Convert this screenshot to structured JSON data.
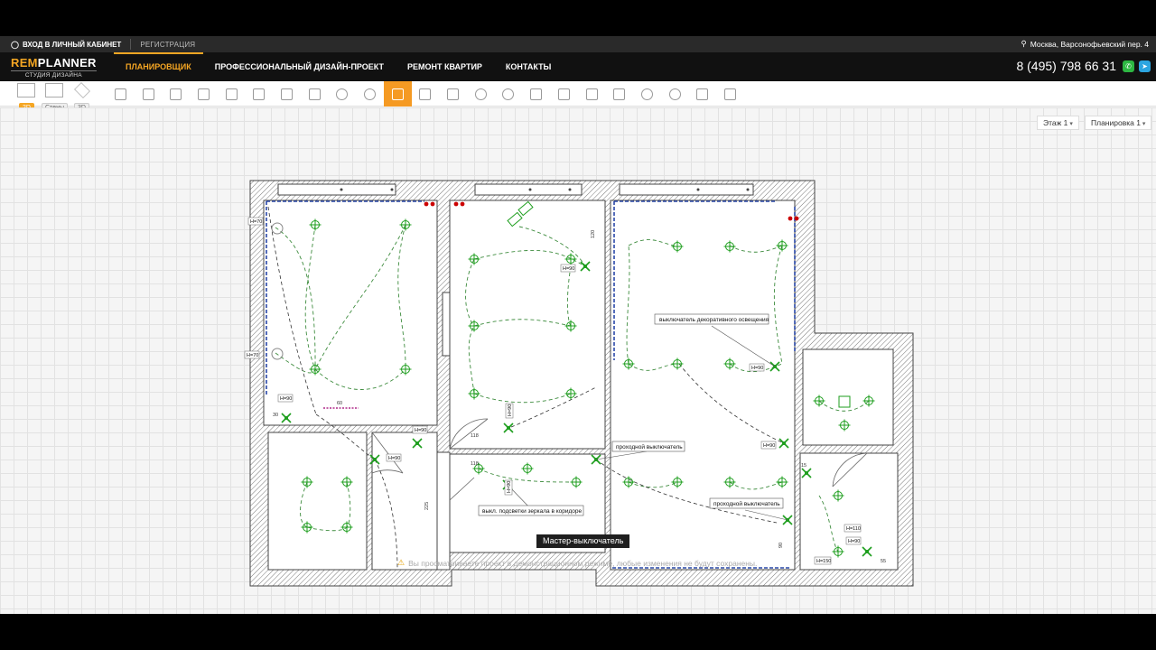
{
  "topbar": {
    "login_label": "ВХОД В ЛИЧНЫЙ КАБИНЕТ",
    "register_label": "РЕГИСТРАЦИЯ",
    "address": "Москва, Варсонофьевский пер. 4"
  },
  "brand": {
    "name_part1": "REM",
    "name_part2": "PLANNER",
    "tagline": "СТУДИЯ ДИЗАЙНА",
    "accent": "#f5a623"
  },
  "nav": {
    "items": [
      "ПЛАНИРОВЩИК",
      "ПРОФЕССИОНАЛЬНЫЙ ДИЗАЙН-ПРОЕКТ",
      "РЕМОНТ КВАРТИР",
      "КОНТАКТЫ"
    ],
    "active_index": 0,
    "phone": "8 (495) 798 66 31",
    "whatsapp_icon": "whatsapp-icon",
    "telegram_icon": "telegram-icon"
  },
  "toolbar": {
    "view_modes": [
      {
        "label": "2D",
        "icon": "plan-2d-icon",
        "active": true
      },
      {
        "label": "Стены",
        "icon": "walls-icon",
        "active": false
      },
      {
        "label": "3D",
        "icon": "cube-3d-icon",
        "active": false
      }
    ],
    "tools": [
      "room-icon",
      "furniture-icon",
      "wall-tile-icon",
      "kitchen-icon",
      "radiator-icon",
      "cabinet-icon",
      "bath-icon",
      "plumbing-icon",
      "socket-icon",
      "ceiling-lamp-icon",
      "switch-icon",
      "floor-heating-icon",
      "ac-icon",
      "fan-icon",
      "camera-icon",
      "antenna-icon",
      "pattern-icon",
      "window-icon",
      "curtain-icon",
      "water-drop-icon",
      "speaker-icon",
      "panel-icon",
      "grid-icon"
    ],
    "active_tool_index": 10
  },
  "workspace": {
    "floor_select": "Этаж 1",
    "layout_select": "Планировка 1"
  },
  "plan": {
    "callouts": [
      "выключатель декоративного освещения",
      "проходной выключатель",
      "проходной выключатель",
      "выкл. подсветки зеркала в коридоре"
    ],
    "height_tags": [
      "H=70",
      "H=70",
      "H=90",
      "H=90",
      "H=90",
      "H=90",
      "H=90",
      "H=90",
      "H=90",
      "H=90",
      "H=110",
      "H=90",
      "H=150"
    ],
    "dimensions": [
      "118",
      "118",
      "225",
      "120",
      "60",
      "55",
      "15",
      "90",
      "30"
    ]
  },
  "status": {
    "tooltip": "Мастер-выключатель",
    "notice": "Вы просматриваете проект в демонстрационном режиме, любые изменения не будут сохранены."
  }
}
